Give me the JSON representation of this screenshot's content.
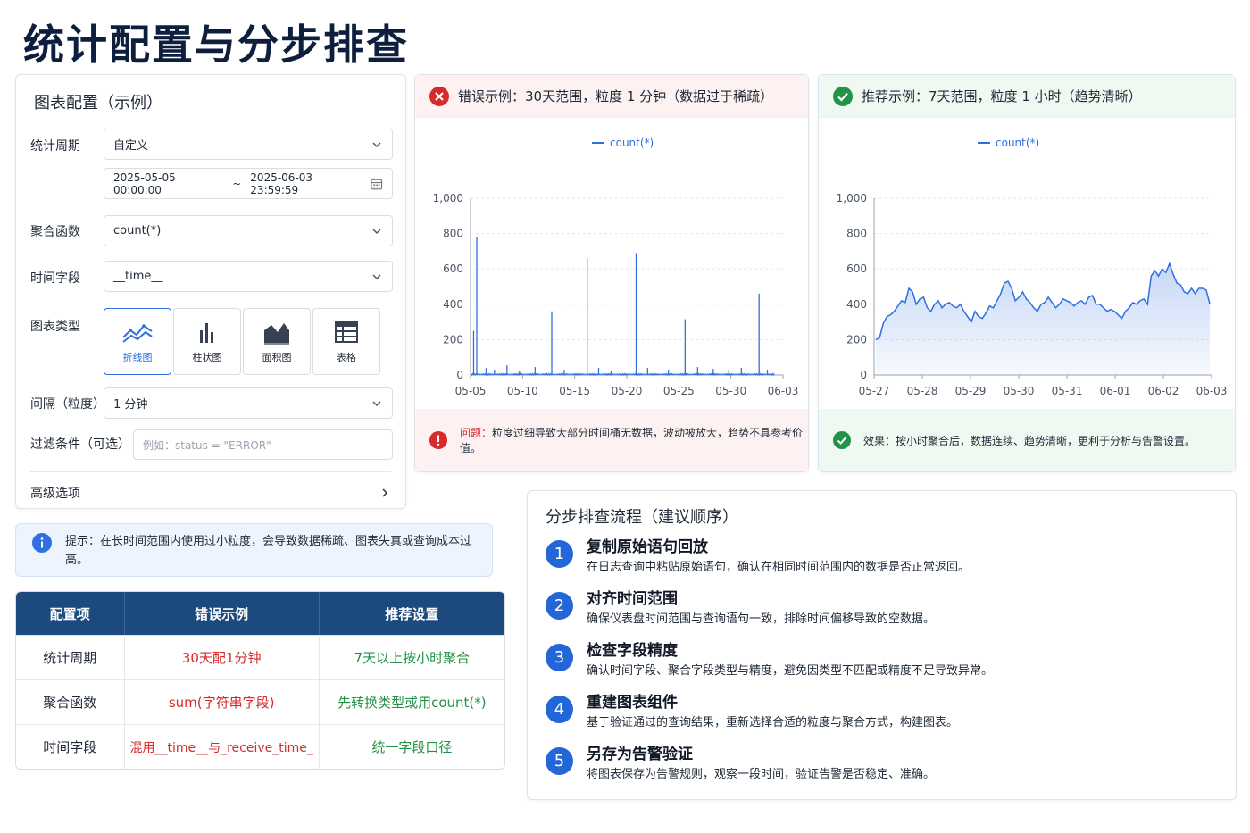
{
  "page": {
    "title": "统计配置与分步排查"
  },
  "config": {
    "title": "图表配置（示例）",
    "period_label": "统计周期",
    "period_value": "自定义",
    "date_start": "2025-05-05 00:00:00",
    "date_sep": "~",
    "date_end": "2025-06-03 23:59:59",
    "agg_label": "聚合函数",
    "agg_value": "count(*)",
    "time_label": "时间字段",
    "time_value": "__time__",
    "chart_type_label": "图表类型",
    "chart_types": [
      "折线图",
      "柱状图",
      "面积图",
      "表格"
    ],
    "interval_label": "间隔（粒度）",
    "interval_value": "1 分钟",
    "filter_label": "过滤条件（可选）",
    "filter_placeholder": "例如：status = \"ERROR\"",
    "advanced_label": "高级选项"
  },
  "tip": {
    "text": "提示：在长时间范围内使用过小粒度，会导致数据稀疏、图表失真或查询成本过高。"
  },
  "table": {
    "headers": [
      "配置项",
      "错误示例",
      "推荐设置"
    ],
    "rows": [
      [
        "统计周期",
        "30天配1分钟",
        "7天以上按小时聚合"
      ],
      [
        "聚合函数",
        "sum(字符串字段)",
        "先转换类型或用count(*)"
      ],
      [
        "时间字段",
        "混用__time__与_receive_time_",
        "统一字段口径"
      ]
    ]
  },
  "error_example": {
    "title": "错误示例：30天范围，粒度 1 分钟（数据过于稀疏）",
    "legend": "count(*)",
    "foot_prefix": "问题：",
    "foot_text": "粒度过细导致大部分时间桶无数据，波动被放大，趋势不具参考价值。"
  },
  "ok_example": {
    "title": "推荐示例：7天范围，粒度 1 小时（趋势清晰）",
    "legend": "count(*)",
    "foot_text": "效果：按小时聚合后，数据连续、趋势清晰，更利于分析与告警设置。"
  },
  "steps": {
    "title": "分步排查流程（建议顺序）",
    "items": [
      {
        "num": "1",
        "title": "复制原始语句回放",
        "desc": "在日志查询中粘贴原始语句，确认在相同时间范围内的数据是否正常返回。"
      },
      {
        "num": "2",
        "title": "对齐时间范围",
        "desc": "确保仪表盘时间范围与查询语句一致，排除时间偏移导致的空数据。"
      },
      {
        "num": "3",
        "title": "检查字段精度",
        "desc": "确认时间字段、聚合字段类型与精度，避免因类型不匹配或精度不足导致异常。"
      },
      {
        "num": "4",
        "title": "重建图表组件",
        "desc": "基于验证通过的查询结果，重新选择合适的粒度与聚合方式，构建图表。"
      },
      {
        "num": "5",
        "title": "另存为告警验证",
        "desc": "将图表保存为告警规则，观察一段时间，验证告警是否稳定、准确。"
      }
    ]
  },
  "colors": {
    "accent": "#2f6fe0",
    "header_bg": "#1c4a7f",
    "bad": "#d62b2b",
    "good": "#219246",
    "line": "#2f6fe0"
  },
  "chart_data": [
    {
      "type": "line",
      "legend": "count(*)",
      "x_ticks": [
        "05-05",
        "05-10",
        "05-15",
        "05-20",
        "05-25",
        "05-30",
        "06-03"
      ],
      "y_ticks": [
        "0",
        "200",
        "400",
        "600",
        "800",
        "1,000"
      ],
      "ylim": [
        0,
        1000
      ],
      "xlim_days": [
        0,
        30
      ],
      "spikes": [
        {
          "x": 0.3,
          "y": 250
        },
        {
          "x": 0.6,
          "y": 780
        },
        {
          "x": 1.5,
          "y": 40
        },
        {
          "x": 2.3,
          "y": 30
        },
        {
          "x": 3.5,
          "y": 55
        },
        {
          "x": 4.7,
          "y": 25
        },
        {
          "x": 6.2,
          "y": 45
        },
        {
          "x": 7.8,
          "y": 360
        },
        {
          "x": 9.0,
          "y": 30
        },
        {
          "x": 11.2,
          "y": 660
        },
        {
          "x": 12.3,
          "y": 40
        },
        {
          "x": 13.5,
          "y": 25
        },
        {
          "x": 15.9,
          "y": 690
        },
        {
          "x": 17.0,
          "y": 40
        },
        {
          "x": 19.0,
          "y": 30
        },
        {
          "x": 20.6,
          "y": 315
        },
        {
          "x": 21.8,
          "y": 45
        },
        {
          "x": 23.3,
          "y": 35
        },
        {
          "x": 24.8,
          "y": 30
        },
        {
          "x": 26.0,
          "y": 40
        },
        {
          "x": 27.7,
          "y": 460
        },
        {
          "x": 28.5,
          "y": 30
        }
      ],
      "baseline_noise": 8
    },
    {
      "type": "area",
      "legend": "count(*)",
      "x_ticks": [
        "05-27",
        "05-28",
        "05-29",
        "05-30",
        "05-31",
        "06-01",
        "06-02",
        "06-03"
      ],
      "y_ticks": [
        "0",
        "200",
        "400",
        "600",
        "800",
        "1,000"
      ],
      "ylim": [
        0,
        1000
      ],
      "values": [
        200,
        210,
        290,
        330,
        340,
        360,
        390,
        420,
        410,
        490,
        470,
        400,
        430,
        440,
        380,
        360,
        400,
        420,
        380,
        400,
        410,
        390,
        380,
        400,
        360,
        330,
        300,
        360,
        330,
        320,
        350,
        390,
        380,
        420,
        460,
        520,
        530,
        490,
        420,
        440,
        470,
        430,
        410,
        380,
        360,
        400,
        410,
        440,
        410,
        380,
        400,
        430,
        420,
        410,
        390,
        410,
        420,
        400,
        440,
        450,
        400,
        400,
        380,
        360,
        370,
        360,
        340,
        320,
        360,
        380,
        410,
        400,
        420,
        430,
        400,
        560,
        590,
        560,
        600,
        580,
        630,
        570,
        520,
        510,
        470,
        460,
        490,
        460,
        490,
        490,
        480,
        400
      ]
    }
  ]
}
